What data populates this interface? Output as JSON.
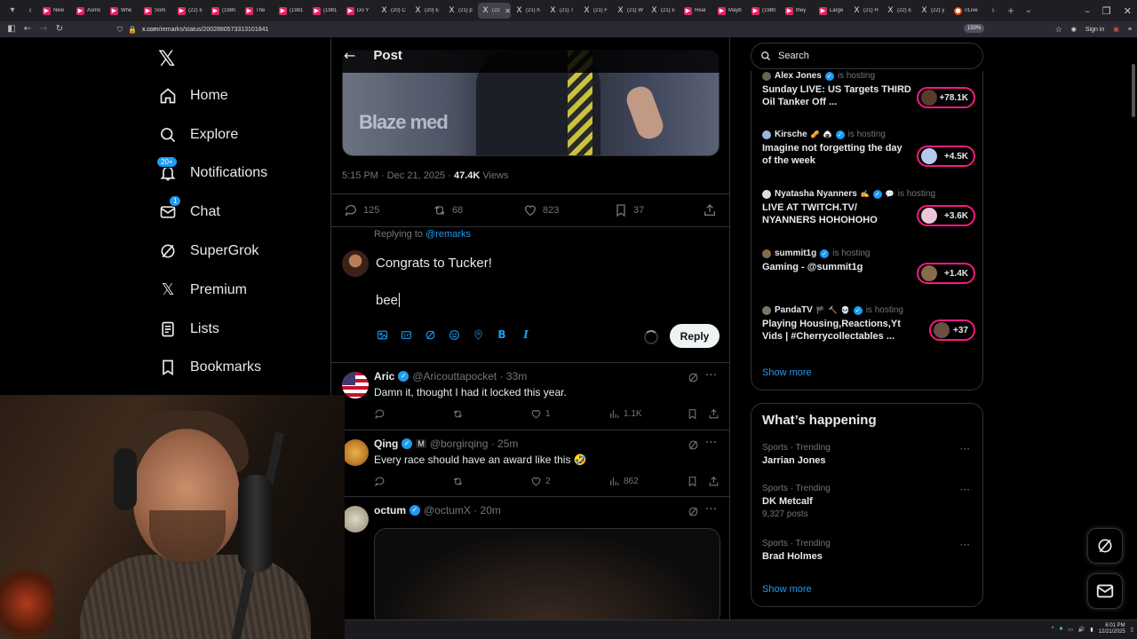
{
  "browser": {
    "tabs": [
      {
        "label": "New",
        "fav": "yt"
      },
      {
        "label": "Asmo",
        "fav": "yt"
      },
      {
        "label": "Whe",
        "fav": "yt"
      },
      {
        "label": "Som",
        "fav": "yt"
      },
      {
        "label": "(22) E",
        "fav": "yt"
      },
      {
        "label": "(1980",
        "fav": "yt"
      },
      {
        "label": "The",
        "fav": "yt"
      },
      {
        "label": "(1981",
        "fav": "yt"
      },
      {
        "label": "(1981",
        "fav": "yt"
      },
      {
        "label": "Do Y",
        "fav": "yt"
      },
      {
        "label": "(20) C",
        "fav": "x"
      },
      {
        "label": "(20) E",
        "fav": "x"
      },
      {
        "label": "(21) p",
        "fav": "x"
      },
      {
        "label": "(22)",
        "fav": "x",
        "active": true
      },
      {
        "label": "(21) h",
        "fav": "x"
      },
      {
        "label": "(21) T",
        "fav": "x"
      },
      {
        "label": "(21) F",
        "fav": "x"
      },
      {
        "label": "(21) W",
        "fav": "x"
      },
      {
        "label": "(21) E",
        "fav": "x"
      },
      {
        "label": "Real",
        "fav": "yt"
      },
      {
        "label": "Mayb",
        "fav": "yt"
      },
      {
        "label": "(1980",
        "fav": "yt"
      },
      {
        "label": "they",
        "fav": "yt"
      },
      {
        "label": "Large",
        "fav": "yt"
      },
      {
        "label": "(21) H",
        "fav": "x"
      },
      {
        "label": "(22) E",
        "fav": "x"
      },
      {
        "label": "(22) y",
        "fav": "x"
      },
      {
        "label": "r/Live",
        "fav": "r"
      }
    ],
    "url_domain": "x.com",
    "url_path": "/remarks/status/2002880573313101841",
    "zoom": "150%",
    "sign_in": "Sign in"
  },
  "logo": "𝕏",
  "nav": {
    "items": [
      {
        "label": "Home",
        "icon": "home-icon"
      },
      {
        "label": "Explore",
        "icon": "search-icon"
      },
      {
        "label": "Notifications",
        "icon": "bell-icon",
        "badge": "20+"
      },
      {
        "label": "Chat",
        "icon": "mail-icon",
        "badge": "1"
      },
      {
        "label": "SuperGrok",
        "icon": "grok-icon"
      },
      {
        "label": "Premium",
        "icon": "x-icon"
      },
      {
        "label": "Lists",
        "icon": "list-icon"
      },
      {
        "label": "Bookmarks",
        "icon": "bookmark-icon"
      }
    ]
  },
  "post": {
    "header_title": "Post",
    "media_brand": "Blaze med",
    "time": "5:15 PM · Dec 21, 2025 · ",
    "views_count": "47.4K",
    "views_label": " Views",
    "replies": "125",
    "reposts": "68",
    "likes": "823",
    "bookmarks": "37"
  },
  "compose": {
    "replying_prefix": "Replying to ",
    "replying_handle": "@remarks",
    "line1": "Congrats to Tucker!",
    "line2": "bee",
    "reply_label": "Reply"
  },
  "replies": [
    {
      "name": "Aric",
      "handle": "@Aricouttapocket · 33m",
      "text": "Damn it, thought I had it locked this year.",
      "replies": "",
      "reposts": "",
      "likes": "1",
      "views": "1.1K"
    },
    {
      "name": "Qing",
      "handle": "@borgirqing · 25m",
      "text": "Every race should have an award like this 🤣",
      "replies": "",
      "reposts": "",
      "likes": "2",
      "views": "862"
    },
    {
      "name": "octum",
      "handle": "@octumX · 20m",
      "text": ""
    }
  ],
  "search": {
    "placeholder": "Search"
  },
  "spaces": [
    {
      "host": "Alex Jones",
      "status": "is hosting",
      "title": "Sunday LIVE: US Targets THIRD Oil Tanker Off ...",
      "listeners": "+78.1K"
    },
    {
      "host": "Kirsche",
      "status": "is hosting",
      "title": "Imagine not forgetting the day of the week",
      "listeners": "+4.5K"
    },
    {
      "host": "Nyatasha Nyanners",
      "status": "is hosting",
      "title": "LIVE AT TWITCH.TV/ NYANNERS HOHOHOHO",
      "listeners": "+3.6K"
    },
    {
      "host": "summit1g",
      "status": "is hosting",
      "title": "Gaming - @summit1g",
      "listeners": "+1.4K"
    },
    {
      "host": "PandaTV",
      "status": "is hosting",
      "title": "Playing Housing,Reactions,Yt Vids | #Cherrycollectables ...",
      "listeners": "+37"
    }
  ],
  "spaces_show_more": "Show more",
  "happening": {
    "title": "What’s happening",
    "trends": [
      {
        "context": "Sports · Trending",
        "name": "Jarrian Jones",
        "count": ""
      },
      {
        "context": "Sports · Trending",
        "name": "DK Metcalf",
        "count": "9,327 posts"
      },
      {
        "context": "Sports · Trending",
        "name": "Brad Holmes",
        "count": ""
      }
    ],
    "show_more": "Show more"
  },
  "taskbar": {
    "time": "6:01 PM",
    "date": "12/21/2025"
  },
  "colors": {
    "accent": "#1d9bf0",
    "live": "#f91880",
    "bg": "#000000",
    "text": "#e7e9ea",
    "muted": "#71767b"
  }
}
